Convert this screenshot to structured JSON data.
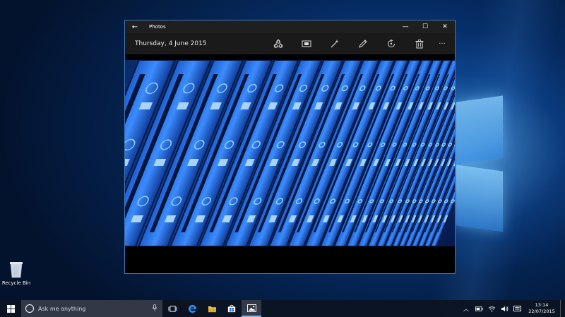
{
  "desktop": {
    "recycle_bin_label": "Recycle Bin"
  },
  "window": {
    "app_title": "Photos",
    "photo_date": "Thursday, 4 June 2015",
    "tools": [
      {
        "name": "share-icon"
      },
      {
        "name": "slideshow-icon"
      },
      {
        "name": "enhance-icon"
      },
      {
        "name": "edit-icon"
      },
      {
        "name": "rotate-icon"
      },
      {
        "name": "delete-icon"
      },
      {
        "name": "more-icon"
      }
    ],
    "more_glyph": "···",
    "controls": {
      "minimize": "—",
      "maximize": "☐",
      "close": "✕"
    }
  },
  "taskbar": {
    "search_placeholder": "Ask me anything",
    "apps": [
      "task-view",
      "edge",
      "file-explorer",
      "store",
      "photos"
    ],
    "time": "13:14",
    "date": "22/07/2015"
  },
  "colors": {
    "accent": "#77b9f0",
    "window_border": "#3f78b6"
  }
}
